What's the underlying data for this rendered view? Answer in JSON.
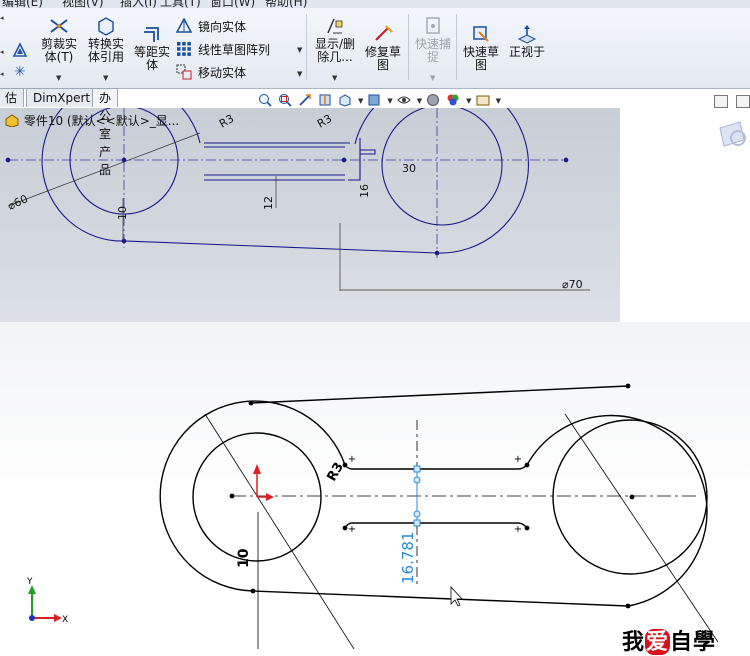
{
  "menubar": {
    "items": [
      "编辑(E)",
      "视图(V)",
      "插入(I)",
      "工具(T)",
      "窗口(W)",
      "帮助(H)"
    ]
  },
  "ribbon": {
    "trim_label": "剪裁实\n体(T)",
    "convert_label": "转换实\n体引用",
    "offset_label": "等距实\n体",
    "mirror_label": "镜向实体",
    "pattern_label": "线性草图阵列",
    "move_label": "移动实体",
    "display_delete_label": "显示/删\n除几...",
    "repair_label": "修复草\n图",
    "quick_snap_label": "快速捕\n捉",
    "rapid_sketch_label": "快速草\n图",
    "normal_to_label": "正视于"
  },
  "tabs": [
    "估",
    "DimXpert",
    "办公室产品"
  ],
  "tree": {
    "part_label": "零件10  (默认<<默认>_显..."
  },
  "upper_dims": {
    "r3_left": "R3",
    "r3_right": "R3",
    "dia60": "⌀60",
    "d10": "10",
    "d12": "12",
    "d16": "16",
    "d30": "30",
    "dia70": "⌀70"
  },
  "lower_dims": {
    "r3": "R3",
    "d10": "10",
    "d16781": "16.781"
  },
  "triad": {
    "x": "X",
    "y": "Y"
  },
  "watermark": {
    "pre": "我",
    "heart": "爱",
    "post": "自學"
  },
  "colors": {
    "sketch_blue": "#1a1a8c",
    "dim_blue": "#2a8ad8",
    "axis_red": "#e02020",
    "axis_green": "#20a020"
  }
}
